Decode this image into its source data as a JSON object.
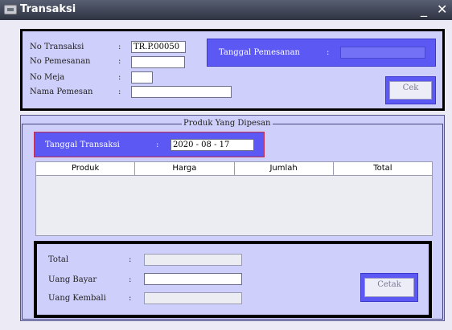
{
  "window": {
    "title": "Transaksi",
    "min_glyph": "_",
    "close_glyph": "✕"
  },
  "order": {
    "no_transaksi_label": "No Transaksi",
    "no_transaksi_value": "TR.P.00050",
    "no_pemesanan_label": "No Pemesanan",
    "no_pemesanan_value": "",
    "no_meja_label": "No Meja",
    "no_meja_value": "",
    "nama_pemesan_label": "Nama Pemesan",
    "nama_pemesan_value": "",
    "tanggal_pemesanan_label": "Tanggal Pemesanan",
    "tanggal_pemesanan_value": "",
    "cek_label": "Cek",
    "colon": ":"
  },
  "products": {
    "group_title": "Produk Yang Dipesan",
    "tanggal_transaksi_label": "Tanggal Transaksi",
    "tanggal_transaksi_value": "2020 - 08 - 17",
    "columns": [
      "Produk",
      "Harga",
      "Jumlah",
      "Total"
    ],
    "rows": []
  },
  "payment": {
    "total_label": "Total",
    "total_value": "",
    "uang_bayar_label": "Uang Bayar",
    "uang_bayar_value": "",
    "uang_kembali_label": "Uang Kembali",
    "uang_kembali_value": "",
    "cetak_label": "Cetak"
  },
  "colors": {
    "panel_bg": "#cfcffb",
    "accent_blue": "#5b58f3",
    "date_border": "#c4304a",
    "titlebar": "#3a3f4d"
  },
  "icons": {
    "title_icon": "window-app-icon"
  }
}
